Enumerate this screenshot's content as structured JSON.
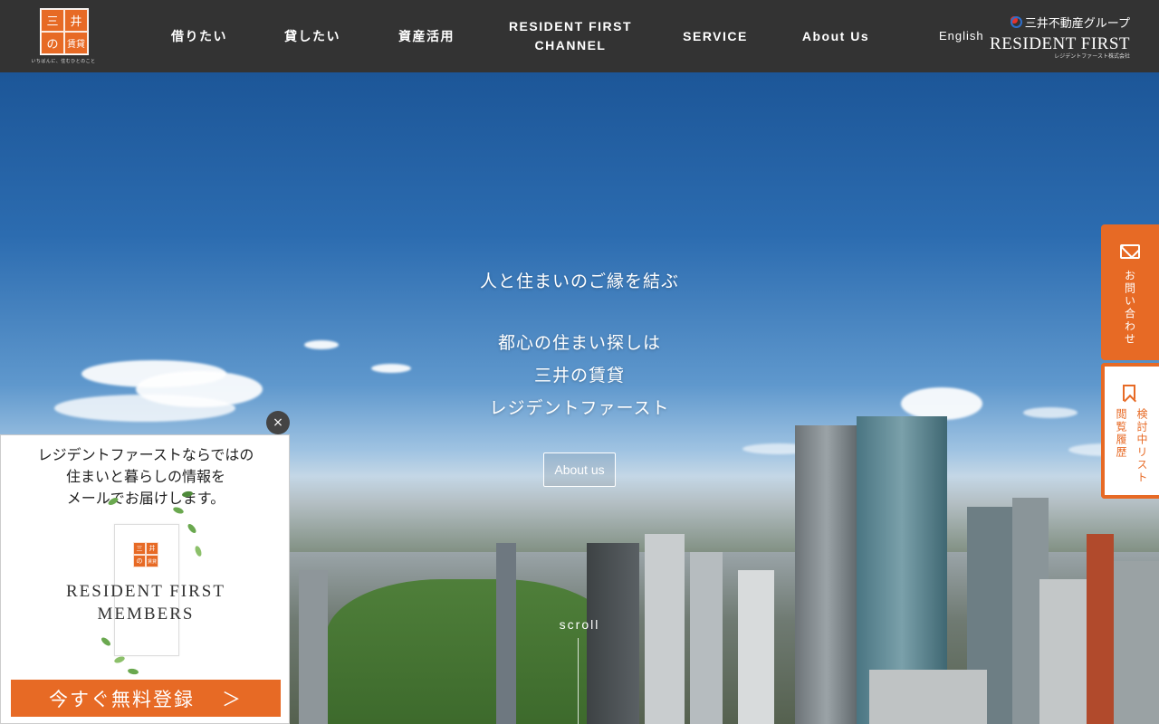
{
  "header": {
    "logo": {
      "chars": [
        "三",
        "井",
        "の",
        "賃貸"
      ],
      "tagline": "いちばんに、住むひとのこと"
    },
    "nav": [
      {
        "label": "借りたい"
      },
      {
        "label": "貸したい"
      },
      {
        "label": "資産活用"
      },
      {
        "label_line1": "RESIDENT FIRST",
        "label_line2": "CHANNEL"
      },
      {
        "label": "SERVICE"
      },
      {
        "label": "About Us"
      }
    ],
    "language": "English",
    "brand": {
      "group": "三井不動産グループ",
      "name": "RESIDENT FIRST",
      "sub": "レジデントファースト株式会社"
    }
  },
  "hero": {
    "tagline": "人と住まいのご縁を結ぶ",
    "lines": [
      "都心の住まい探しは",
      "三井の賃貸",
      "レジデントファースト"
    ],
    "about_button": "About us",
    "scroll_label": "scroll"
  },
  "side": {
    "contact_label": "お問い合わせ",
    "list_label": "検討中リスト",
    "history_label": "閲覧履歴"
  },
  "popup": {
    "close": "×",
    "message_lines": [
      "レジデントファーストならではの",
      "住まいと暮らしの情報を",
      "メールでお届けします。"
    ],
    "members_line1": "RESIDENT FIRST",
    "members_line2": "MEMBERS",
    "register_label": "今すぐ無料登録",
    "register_arrow": "＞"
  },
  "colors": {
    "accent": "#e76a25",
    "header_bg": "#333333"
  }
}
